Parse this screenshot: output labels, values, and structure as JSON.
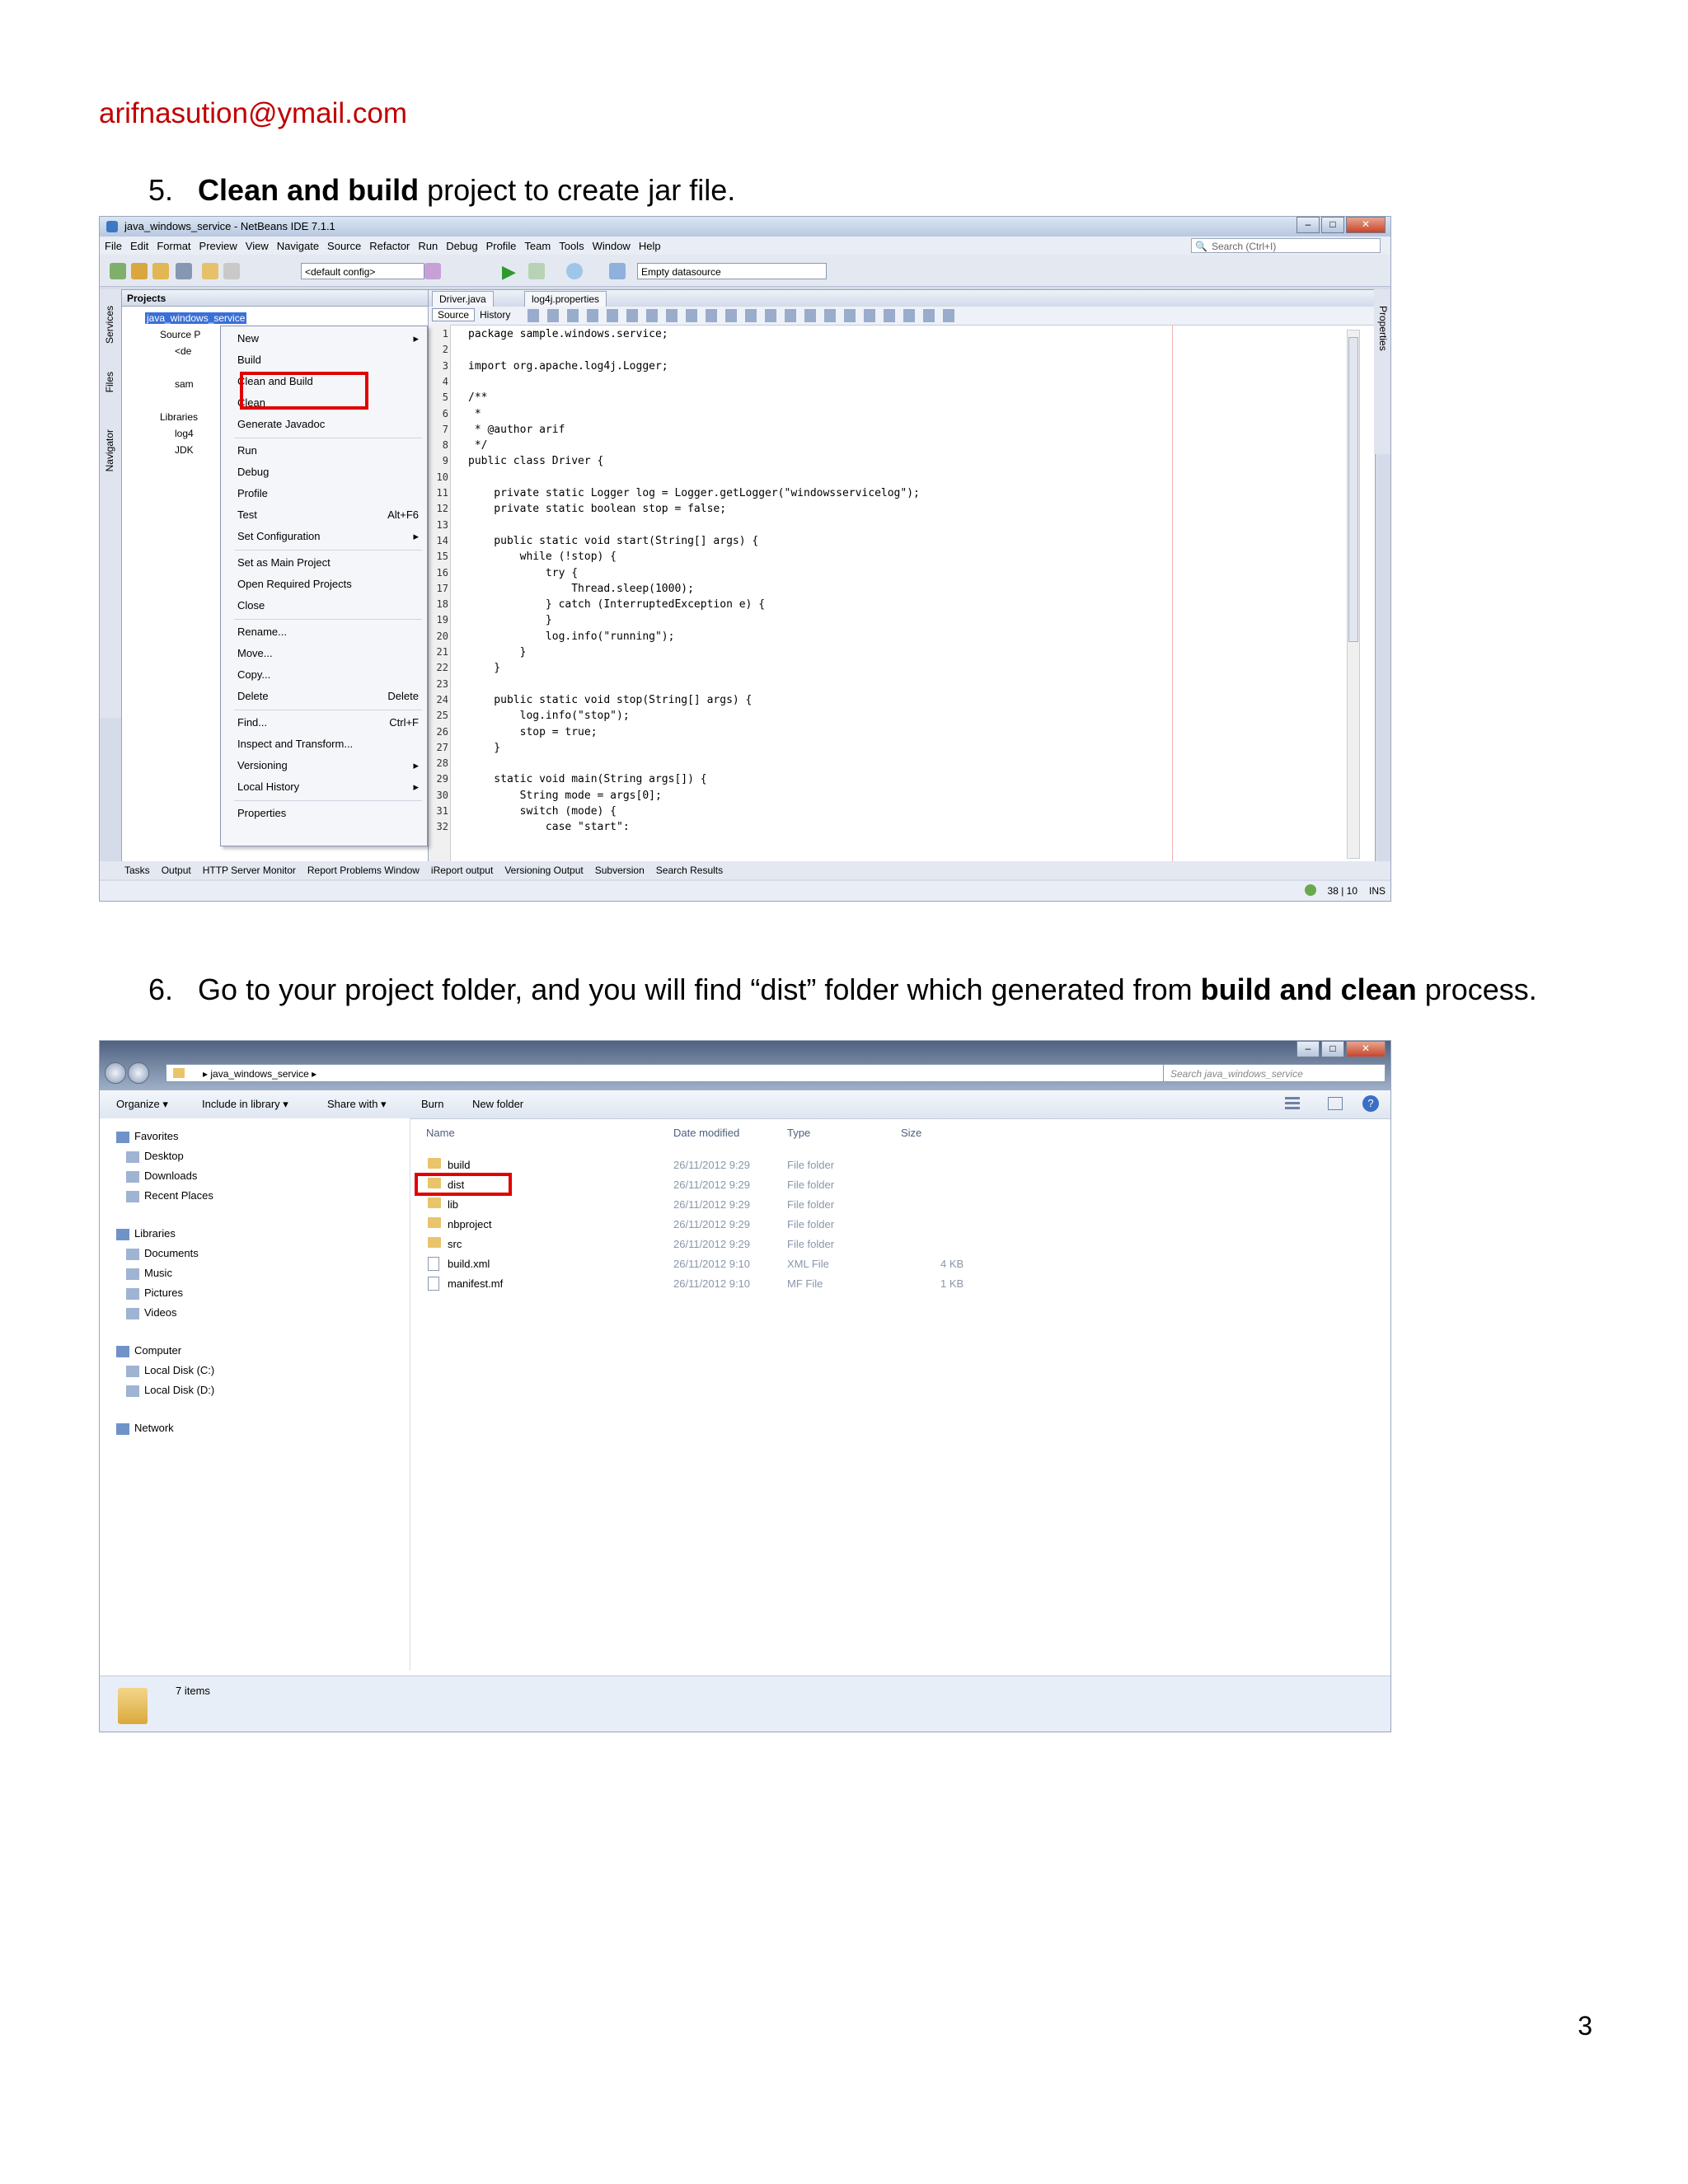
{
  "email": "arifnasution@ymail.com",
  "page_number": "3",
  "step5": {
    "num": "5.",
    "bold": "Clean and build",
    "rest": " project to create jar file."
  },
  "step6": {
    "num": "6.",
    "text1": "Go to your project folder, and you will find “dist” folder which generated from ",
    "bold": "build and clean",
    "text2": " process."
  },
  "netbeans": {
    "title": "java_windows_service - NetBeans IDE 7.1.1",
    "menu": [
      "File",
      "Edit",
      "Format",
      "Preview",
      "View",
      "Navigate",
      "Source",
      "Refactor",
      "Run",
      "Debug",
      "Profile",
      "Team",
      "Tools",
      "Window",
      "Help"
    ],
    "search_placeholder": "Search (Ctrl+I)",
    "config_combo": "<default config>",
    "datasource_combo": "Empty datasource",
    "side_tabs": [
      "Services",
      "Files",
      "Navigator"
    ],
    "right_tab": "Properties",
    "projects_tab": "Projects",
    "tree": [
      "java_windows_service",
      "Source P",
      "<de",
      "",
      "sam",
      "",
      "Libraries",
      "log4",
      "JDK"
    ],
    "context_menu": [
      {
        "label": "New",
        "shortcut": "",
        "arrow": true
      },
      {
        "label": "Build",
        "shortcut": "",
        "arrow": false
      },
      {
        "label": "Clean and Build",
        "shortcut": "",
        "arrow": false
      },
      {
        "label": "Clean",
        "shortcut": "",
        "arrow": false
      },
      {
        "label": "Generate Javadoc",
        "shortcut": "",
        "arrow": false
      },
      {
        "label": "Run",
        "shortcut": "",
        "arrow": false
      },
      {
        "label": "Debug",
        "shortcut": "",
        "arrow": false
      },
      {
        "label": "Profile",
        "shortcut": "",
        "arrow": false
      },
      {
        "label": "Test",
        "shortcut": "Alt+F6",
        "arrow": false
      },
      {
        "label": "Set Configuration",
        "shortcut": "",
        "arrow": true
      },
      {
        "label": "Set as Main Project",
        "shortcut": "",
        "arrow": false
      },
      {
        "label": "Open Required Projects",
        "shortcut": "",
        "arrow": false
      },
      {
        "label": "Close",
        "shortcut": "",
        "arrow": false
      },
      {
        "label": "Rename...",
        "shortcut": "",
        "arrow": false
      },
      {
        "label": "Move...",
        "shortcut": "",
        "arrow": false
      },
      {
        "label": "Copy...",
        "shortcut": "",
        "arrow": false
      },
      {
        "label": "Delete",
        "shortcut": "Delete",
        "arrow": false
      },
      {
        "label": "Find...",
        "shortcut": "Ctrl+F",
        "arrow": false
      },
      {
        "label": "Inspect and Transform...",
        "shortcut": "",
        "arrow": false
      },
      {
        "label": "Versioning",
        "shortcut": "",
        "arrow": true
      },
      {
        "label": "Local History",
        "shortcut": "",
        "arrow": true
      },
      {
        "label": "Properties",
        "shortcut": "",
        "arrow": false
      }
    ],
    "editor_tabs": [
      "Driver.java",
      "log4j.properties"
    ],
    "editor_views": [
      "Source",
      "History"
    ],
    "code": [
      "package sample.windows.service;",
      "",
      "import org.apache.log4j.Logger;",
      "",
      "/**",
      " *",
      " * @author arif",
      " */",
      "public class Driver {",
      "",
      "    private static Logger log = Logger.getLogger(\"windowsservicelog\");",
      "    private static boolean stop = false;",
      "",
      "    public static void start(String[] args) {",
      "        while (!stop) {",
      "            try {",
      "                Thread.sleep(1000);",
      "            } catch (InterruptedException e) {",
      "            }",
      "            log.info(\"running\");",
      "        }",
      "    }",
      "",
      "    public static void stop(String[] args) {",
      "        log.info(\"stop\");",
      "        stop = true;",
      "    }",
      "",
      "    static void main(String args[]) {",
      "        String mode = args[0];",
      "        switch (mode) {",
      "            case \"start\":"
    ],
    "bottom_tabs": [
      "Tasks",
      "Output",
      "HTTP Server Monitor",
      "Report Problems Window",
      "iReport output",
      "Versioning Output",
      "Subversion",
      "Search Results"
    ],
    "status_pos": "38 | 10",
    "status_mode": "INS"
  },
  "explorer": {
    "address": [
      "java_windows_service"
    ],
    "search_placeholder": "Search java_windows_service",
    "commands": [
      "Organize",
      "Include in library",
      "Share with",
      "Burn",
      "New folder"
    ],
    "nav": [
      {
        "label": "Favorites",
        "indent": 0,
        "icon": "star-icon",
        "gap": false
      },
      {
        "label": "Desktop",
        "indent": 1,
        "icon": "desktop-icon",
        "gap": false
      },
      {
        "label": "Downloads",
        "indent": 1,
        "icon": "downloads-icon",
        "gap": false
      },
      {
        "label": "Recent Places",
        "indent": 1,
        "icon": "recent-places-icon",
        "gap": false
      },
      {
        "label": "Libraries",
        "indent": 0,
        "icon": "libraries-icon",
        "gap": true
      },
      {
        "label": "Documents",
        "indent": 1,
        "icon": "documents-icon",
        "gap": false
      },
      {
        "label": "Music",
        "indent": 1,
        "icon": "music-icon",
        "gap": false
      },
      {
        "label": "Pictures",
        "indent": 1,
        "icon": "pictures-icon",
        "gap": false
      },
      {
        "label": "Videos",
        "indent": 1,
        "icon": "videos-icon",
        "gap": false
      },
      {
        "label": "Computer",
        "indent": 0,
        "icon": "computer-icon",
        "gap": true
      },
      {
        "label": "Local Disk (C:)",
        "indent": 1,
        "icon": "disk-icon",
        "gap": false
      },
      {
        "label": "Local Disk (D:)",
        "indent": 1,
        "icon": "disk-icon",
        "gap": false
      },
      {
        "label": "Network",
        "indent": 0,
        "icon": "network-icon",
        "gap": true
      }
    ],
    "columns": [
      "Name",
      "Date modified",
      "Type",
      "Size"
    ],
    "files": [
      {
        "name": "build",
        "date": "26/11/2012 9:29",
        "type": "File folder",
        "size": "",
        "folder": true
      },
      {
        "name": "dist",
        "date": "26/11/2012 9:29",
        "type": "File folder",
        "size": "",
        "folder": true
      },
      {
        "name": "lib",
        "date": "26/11/2012 9:29",
        "type": "File folder",
        "size": "",
        "folder": true
      },
      {
        "name": "nbproject",
        "date": "26/11/2012 9:29",
        "type": "File folder",
        "size": "",
        "folder": true
      },
      {
        "name": "src",
        "date": "26/11/2012 9:29",
        "type": "File folder",
        "size": "",
        "folder": true
      },
      {
        "name": "build.xml",
        "date": "26/11/2012 9:10",
        "type": "XML File",
        "size": "4 KB",
        "folder": false
      },
      {
        "name": "manifest.mf",
        "date": "26/11/2012 9:10",
        "type": "MF File",
        "size": "1 KB",
        "folder": false
      }
    ],
    "item_count": "7 items"
  },
  "colors": {
    "email": "#c00000",
    "highlight_box": "#e00000",
    "selection": "#3a6fd8"
  }
}
